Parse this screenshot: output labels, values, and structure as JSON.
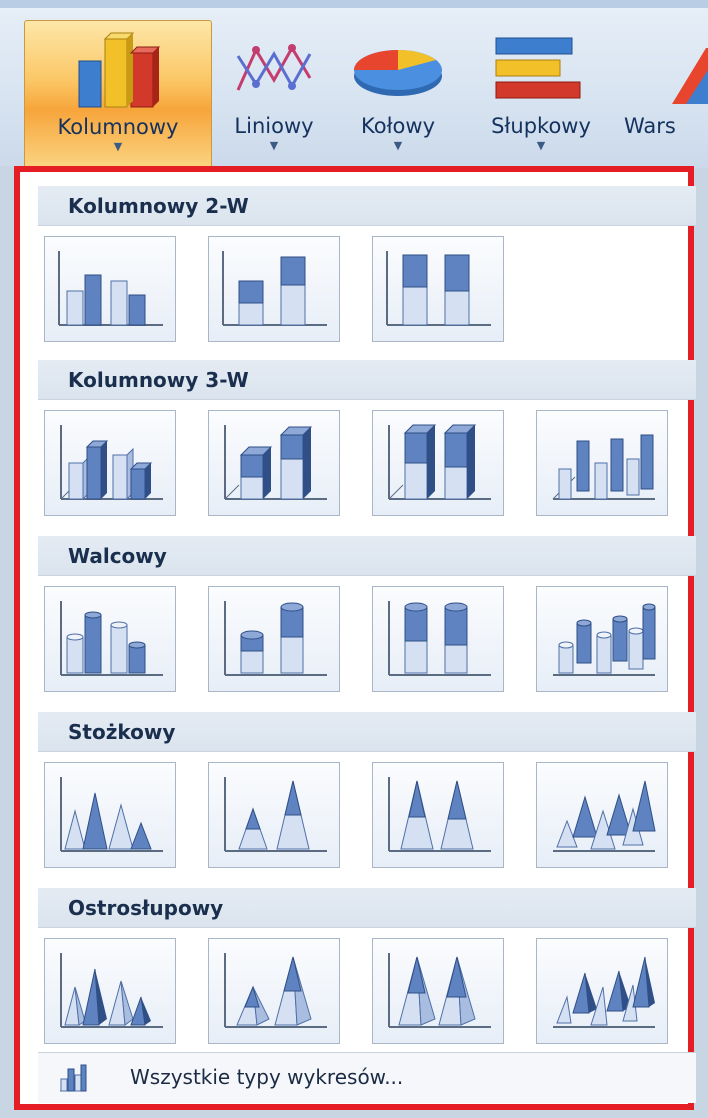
{
  "ribbon": {
    "buttons": [
      {
        "label": "Kolumnowy",
        "icon": "column-chart-icon"
      },
      {
        "label": "Liniowy",
        "icon": "line-chart-icon"
      },
      {
        "label": "Kołowy",
        "icon": "pie-chart-icon"
      },
      {
        "label": "Słupkowy",
        "icon": "bar-chart-icon"
      },
      {
        "label": "Wars",
        "icon": "area-chart-icon"
      }
    ]
  },
  "sections": [
    {
      "title": "Kolumnowy 2-W",
      "variants": [
        "clustered-column-icon",
        "stacked-column-icon",
        "100-percent-stacked-column-icon"
      ]
    },
    {
      "title": "Kolumnowy 3-W",
      "variants": [
        "3d-clustered-column-icon",
        "3d-stacked-column-icon",
        "3d-100-percent-stacked-column-icon",
        "3d-column-icon"
      ]
    },
    {
      "title": "Walcowy",
      "variants": [
        "clustered-cylinder-icon",
        "stacked-cylinder-icon",
        "100-percent-stacked-cylinder-icon",
        "3d-cylinder-icon"
      ]
    },
    {
      "title": "Stożkowy",
      "variants": [
        "clustered-cone-icon",
        "stacked-cone-icon",
        "100-percent-stacked-cone-icon",
        "3d-cone-icon"
      ]
    },
    {
      "title": "Ostrosłupowy",
      "variants": [
        "clustered-pyramid-icon",
        "stacked-pyramid-icon",
        "100-percent-stacked-pyramid-icon",
        "3d-pyramid-icon"
      ]
    }
  ],
  "footer": {
    "label": "Wszystkie typy wykresów...",
    "icon": "all-chart-types-icon"
  },
  "colors": {
    "accent_border": "#e51e26",
    "selected_button": "#f7a53b",
    "glyph_blue": "#4f6fa7"
  }
}
